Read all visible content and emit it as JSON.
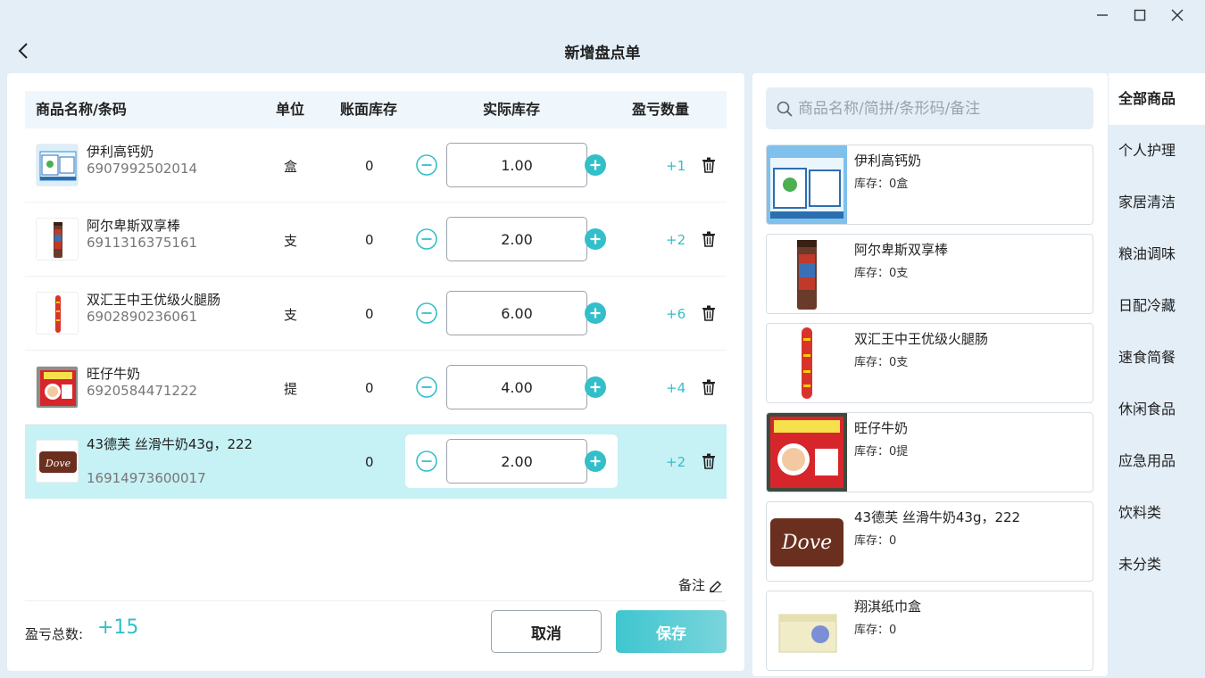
{
  "header": {
    "title": "新增盘点单"
  },
  "table": {
    "columns": {
      "name": "商品名称/条码",
      "unit": "单位",
      "book": "账面库存",
      "actual": "实际库存",
      "diff": "盈亏数量"
    },
    "rows": [
      {
        "name": "伊利高钙奶",
        "code": "6907992502014",
        "unit": "盒",
        "book": "0",
        "qty": "1.00",
        "diff": "+1",
        "image": "milk-box-image"
      },
      {
        "name": "阿尔卑斯双享棒",
        "code": "6911316375161",
        "unit": "支",
        "book": "0",
        "qty": "2.00",
        "diff": "+2",
        "image": "candy-stick-image"
      },
      {
        "name": "双汇王中王优级火腿肠",
        "code": "6902890236061",
        "unit": "支",
        "book": "0",
        "qty": "6.00",
        "diff": "+6",
        "image": "sausage-image"
      },
      {
        "name": "旺仔牛奶",
        "code": "6920584471222",
        "unit": "提",
        "book": "0",
        "qty": "4.00",
        "diff": "+4",
        "image": "wangzai-milk-image"
      },
      {
        "name": "43德芙 丝滑牛奶43g，222",
        "code": "16914973600017",
        "unit": "",
        "book": "0",
        "qty": "2.00",
        "diff": "+2",
        "image": "dove-chocolate-image"
      }
    ]
  },
  "footer": {
    "note_label": "备注",
    "total_label": "盈亏总数:",
    "total_value": "+15",
    "cancel_label": "取消",
    "save_label": "保存"
  },
  "search": {
    "placeholder": "商品名称/简拼/条形码/备注"
  },
  "products": [
    {
      "name": "伊利高钙奶",
      "stock": "库存：0盒"
    },
    {
      "name": "阿尔卑斯双享棒",
      "stock": "库存：0支"
    },
    {
      "name": "双汇王中王优级火腿肠",
      "stock": "库存：0支"
    },
    {
      "name": "旺仔牛奶",
      "stock": "库存：0提"
    },
    {
      "name": "43德芙 丝滑牛奶43g，222",
      "stock": "库存：0"
    },
    {
      "name": "翔淇纸巾盒",
      "stock": "库存：0"
    }
  ],
  "categories": [
    "全部商品",
    "个人护理",
    "家居清洁",
    "粮油调味",
    "日配冷藏",
    "速食简餐",
    "休闲食品",
    "应急用品",
    "饮料类",
    "未分类"
  ],
  "colors": {
    "accent": "#33bfca",
    "selected_row": "#c6f1f5",
    "page_bg": "#e3eef7"
  }
}
